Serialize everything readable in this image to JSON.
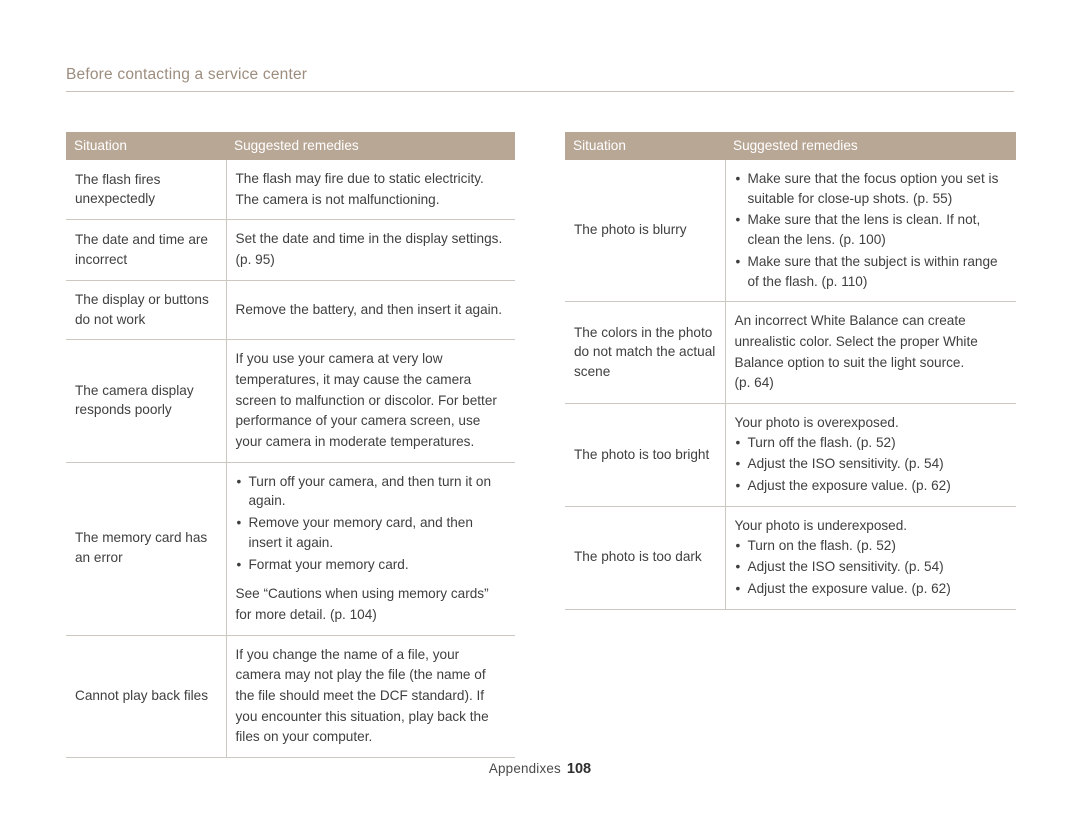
{
  "header": {
    "title": "Before contacting a service center"
  },
  "footer": {
    "label": "Appendixes",
    "page_number": "108"
  },
  "tables": {
    "left": {
      "columns": [
        "Situation",
        "Suggested remedies"
      ],
      "rows": [
        {
          "situation": "The flash fires unexpectedly",
          "remedy_lines": [
            "The flash may fire due to static electricity.",
            "The camera is not malfunctioning."
          ]
        },
        {
          "situation": "The date and time are incorrect",
          "remedy_lines": [
            "Set the date and time in the display settings.",
            "(p. 95)"
          ]
        },
        {
          "situation": "The display or buttons do not work",
          "remedy_lines": [
            "Remove the battery, and then insert it again."
          ]
        },
        {
          "situation": "The camera display responds poorly",
          "remedy_lines": [
            "If you use your camera at very low",
            "temperatures, it may cause the camera",
            "screen to malfunction or discolor. For better",
            "performance of your camera screen, use",
            "your camera in moderate temperatures."
          ]
        },
        {
          "situation": "The memory card has an error",
          "bullets": [
            "Turn off your camera, and then turn it on again.",
            "Remove your memory card, and then insert it again.",
            "Format your memory card."
          ],
          "remedy_lines": [
            "See “Cautions when using memory cards”",
            "for more detail. (p. 104)"
          ]
        },
        {
          "situation": "Cannot play back files",
          "remedy_lines": [
            "If you change the name of a file, your",
            "camera may not play the file (the name of",
            "the file should meet the DCF standard). If",
            "you encounter this situation, play back the",
            "files on your computer."
          ]
        }
      ]
    },
    "right": {
      "columns": [
        "Situation",
        "Suggested remedies"
      ],
      "rows": [
        {
          "situation": "The photo is blurry",
          "bullets": [
            "Make sure that the focus option you set is suitable for close-up shots. (p. 55)",
            "Make sure that the lens is clean. If not, clean the lens. (p. 100)",
            "Make sure that the subject is within range of the flash. (p. 110)"
          ]
        },
        {
          "situation": "The colors in the photo do not match the actual scene",
          "remedy_lines": [
            "An incorrect White Balance can create",
            "unrealistic color. Select the proper White",
            "Balance option to suit the light source.",
            "(p. 64)"
          ]
        },
        {
          "situation": "The photo is too bright",
          "intro": "Your photo is overexposed.",
          "bullets": [
            "Turn off the flash. (p. 52)",
            "Adjust the ISO sensitivity. (p. 54)",
            "Adjust the exposure value. (p. 62)"
          ]
        },
        {
          "situation": "The photo is too dark",
          "intro": "Your photo is underexposed.",
          "bullets": [
            "Turn on the flash. (p. 52)",
            "Adjust the ISO sensitivity. (p. 54)",
            "Adjust the exposure value. (p. 62)"
          ]
        }
      ]
    }
  }
}
